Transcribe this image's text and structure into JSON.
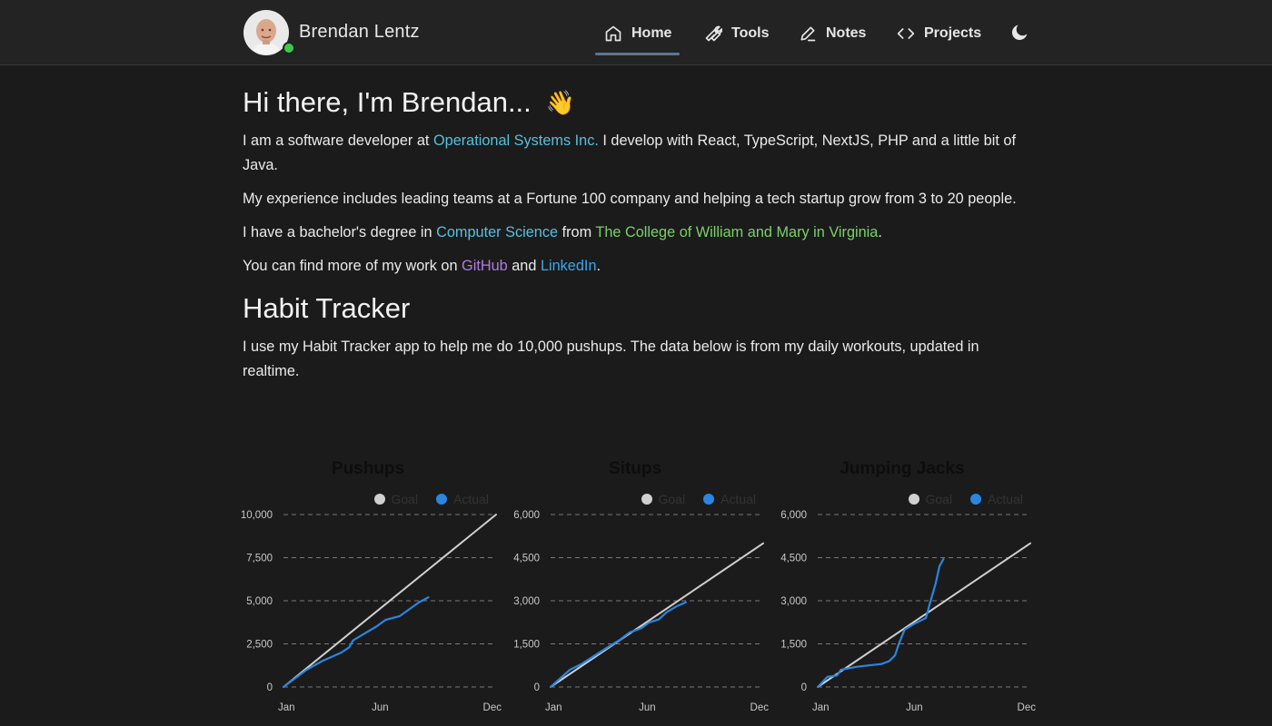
{
  "header": {
    "site_name": "Brendan Lentz",
    "nav": [
      {
        "label": "Home",
        "icon": "home-icon",
        "active": true
      },
      {
        "label": "Tools",
        "icon": "wrench-icon"
      },
      {
        "label": "Notes",
        "icon": "pencil-icon"
      },
      {
        "label": "Projects",
        "icon": "code-icon"
      }
    ],
    "theme_icon": "moon-icon"
  },
  "intro": {
    "greeting": "Hi there, I'm Brendan...",
    "wave": "👋",
    "p1_before": "I am a software developer at ",
    "p1_link": "Operational Systems Inc.",
    "p1_after": " I develop with React, TypeScript, NextJS, PHP and a little bit of Java.",
    "p2": "My experience includes leading teams at a Fortune 100 company and helping a tech startup grow from 3 to 20 people.",
    "p3_before": "I have a bachelor's degree in ",
    "p3_link1": "Computer Science",
    "p3_mid": " from ",
    "p3_link2": "The College of William and Mary in Virginia",
    "p3_after": ".",
    "p4_before": "You can find more of my work on ",
    "p4_link1": "GitHub",
    "p4_mid": " and ",
    "p4_link2": "LinkedIn",
    "p4_after": "."
  },
  "habit": {
    "heading": "Habit Tracker",
    "description": "I use my Habit Tracker app to help me do 10,000 pushups. The data below is from my daily workouts, updated in realtime."
  },
  "colors": {
    "goal": "#d0d0d0",
    "actual": "#2a86e0",
    "grid": "#7a7a7a"
  },
  "chart_data": [
    {
      "type": "line",
      "title": "Pushups",
      "legend": [
        "Goal",
        "Actual"
      ],
      "x_ticks": [
        "Jan",
        "Jun",
        "Dec"
      ],
      "y_ticks": [
        "0",
        "2,500",
        "5,000",
        "7,500",
        "10,000"
      ],
      "ylim": [
        0,
        10000
      ],
      "xlim_month": [
        0,
        11
      ],
      "series": [
        {
          "name": "Goal",
          "points": [
            [
              0,
              0
            ],
            [
              11,
              10000
            ]
          ]
        },
        {
          "name": "Actual",
          "points": [
            [
              0,
              0
            ],
            [
              0.6,
              500
            ],
            [
              1.2,
              1000
            ],
            [
              2,
              1500
            ],
            [
              3,
              2000
            ],
            [
              3.4,
              2300
            ],
            [
              3.6,
              2700
            ],
            [
              4.2,
              3100
            ],
            [
              4.8,
              3500
            ],
            [
              5.3,
              3900
            ],
            [
              6,
              4100
            ],
            [
              6.5,
              4500
            ],
            [
              7,
              4900
            ],
            [
              7.5,
              5200
            ]
          ]
        }
      ]
    },
    {
      "type": "line",
      "title": "Situps",
      "legend": [
        "Goal",
        "Actual"
      ],
      "x_ticks": [
        "Jan",
        "Jun",
        "Dec"
      ],
      "y_ticks": [
        "0",
        "1,500",
        "3,000",
        "4,500",
        "6,000"
      ],
      "ylim": [
        0,
        6000
      ],
      "xlim_month": [
        0,
        11
      ],
      "series": [
        {
          "name": "Goal",
          "points": [
            [
              0,
              0
            ],
            [
              11,
              5000
            ]
          ]
        },
        {
          "name": "Actual",
          "points": [
            [
              0,
              0
            ],
            [
              0.5,
              300
            ],
            [
              1,
              600
            ],
            [
              1.6,
              800
            ],
            [
              2.3,
              1100
            ],
            [
              3,
              1400
            ],
            [
              3.6,
              1650
            ],
            [
              4.1,
              1900
            ],
            [
              4.7,
              2050
            ],
            [
              5.1,
              2250
            ],
            [
              5.6,
              2350
            ],
            [
              6,
              2600
            ],
            [
              6.5,
              2800
            ],
            [
              7,
              2950
            ]
          ]
        }
      ]
    },
    {
      "type": "line",
      "title": "Jumping Jacks",
      "legend": [
        "Goal",
        "Actual"
      ],
      "x_ticks": [
        "Jan",
        "Jun",
        "Dec"
      ],
      "y_ticks": [
        "0",
        "1,500",
        "3,000",
        "4,500",
        "6,000"
      ],
      "ylim": [
        0,
        6000
      ],
      "xlim_month": [
        0,
        11
      ],
      "series": [
        {
          "name": "Goal",
          "points": [
            [
              0,
              0
            ],
            [
              11,
              5000
            ]
          ]
        },
        {
          "name": "Actual",
          "points": [
            [
              0,
              0
            ],
            [
              0.5,
              350
            ],
            [
              1,
              400
            ],
            [
              1.2,
              600
            ],
            [
              2,
              700
            ],
            [
              2.6,
              750
            ],
            [
              3.3,
              800
            ],
            [
              3.7,
              900
            ],
            [
              4,
              1100
            ],
            [
              4.2,
              1500
            ],
            [
              4.5,
              2000
            ],
            [
              5,
              2200
            ],
            [
              5.6,
              2400
            ],
            [
              5.8,
              2900
            ],
            [
              6.1,
              3600
            ],
            [
              6.3,
              4200
            ],
            [
              6.5,
              4450
            ]
          ]
        }
      ]
    }
  ]
}
